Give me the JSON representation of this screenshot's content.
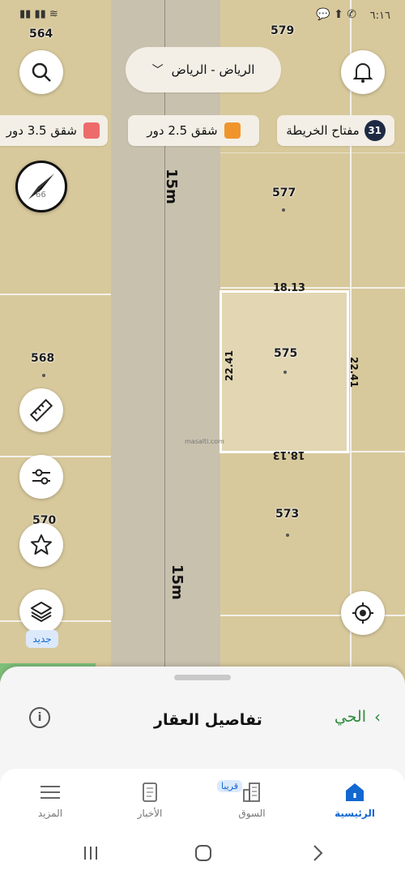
{
  "status_bar": {
    "time": "٦:١٦"
  },
  "search": {
    "city_label": "الرياض - الرياض"
  },
  "map_key": {
    "label": "مفتاح الخريطة",
    "count": "31"
  },
  "legend": [
    {
      "label": "شقق 2.5 دور",
      "color": "#f0952c"
    },
    {
      "label": "شقق 3.5 دور",
      "color": "#ee6b6b"
    }
  ],
  "compass": {
    "value": "66"
  },
  "street_labels": {
    "top": "15m",
    "bottom": "15m"
  },
  "plots": {
    "p564": "564",
    "p579": "579",
    "p577": "577",
    "p568": "568",
    "p575": "575",
    "p570": "570",
    "p573": "573"
  },
  "dimensions": {
    "top": "18.13",
    "bottom": "18.13",
    "left": "22.41",
    "right": "22.41"
  },
  "watermark": "masalti.com",
  "new_badge": "جديد",
  "sheet": {
    "title": "تفاصيل العقار",
    "link": "الحي"
  },
  "nav": {
    "home": "الرئيسية",
    "market": "السوق",
    "market_badge": "قريبا",
    "news": "الأخبار",
    "more": "المزيد"
  },
  "colors": {
    "accent": "#1267d0",
    "selected_plot": "#e2d6b3"
  }
}
